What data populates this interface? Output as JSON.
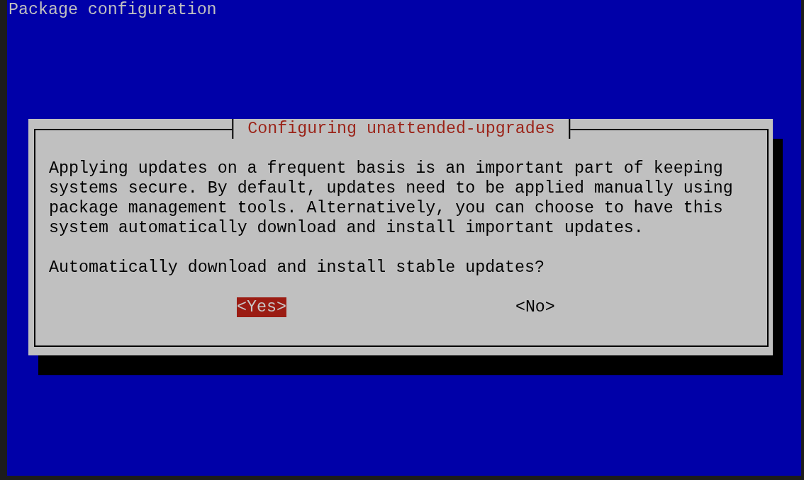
{
  "window": {
    "title": "Package configuration"
  },
  "dialog": {
    "title": "Configuring unattended-upgrades",
    "message": "Applying updates on a frequent basis is an important part of keeping systems secure. By default, updates need to be applied manually using package management tools. Alternatively, you can choose to have this system automatically download and install important updates.",
    "question": "Automatically download and install stable updates?",
    "buttons": [
      {
        "label": "<Yes>",
        "selected": true
      },
      {
        "label": "<No>",
        "selected": false
      }
    ]
  }
}
